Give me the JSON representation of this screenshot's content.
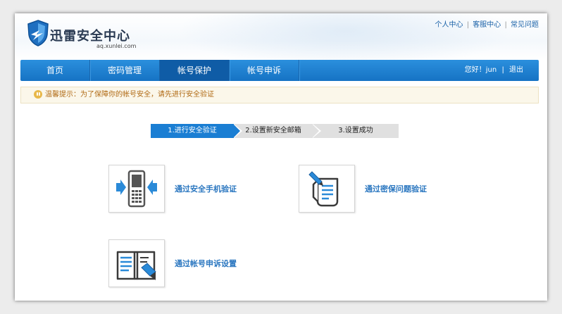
{
  "header": {
    "logo_text": "迅雷安全中心",
    "logo_sub": "aq.xunlei.com",
    "links": [
      "个人中心",
      "客服中心",
      "常见问题"
    ],
    "link_separator": "|"
  },
  "nav": {
    "items": [
      {
        "label": "首页"
      },
      {
        "label": "密码管理"
      },
      {
        "label": "帐号保护",
        "active": true
      },
      {
        "label": "帐号申诉"
      }
    ],
    "greeting": "您好！jun",
    "separator": "|",
    "logout": "退出"
  },
  "tip": {
    "text": "温馨提示：为了保障你的帐号安全，请先进行安全验证"
  },
  "steps": [
    {
      "label": "1.进行安全验证",
      "active": true
    },
    {
      "label": "2.设置新安全邮箱",
      "active": false
    },
    {
      "label": "3.设置成功",
      "active": false
    }
  ],
  "options": [
    {
      "label": "通过安全手机验证",
      "icon": "phone-verify-icon"
    },
    {
      "label": "通过密保问题验证",
      "icon": "security-question-icon"
    },
    {
      "label": "通过帐号申诉设置",
      "icon": "account-appeal-icon"
    }
  ],
  "colors": {
    "nav_blue": "#1a7ed3",
    "link_blue": "#2b77c0",
    "tip_text": "#b06a14"
  }
}
